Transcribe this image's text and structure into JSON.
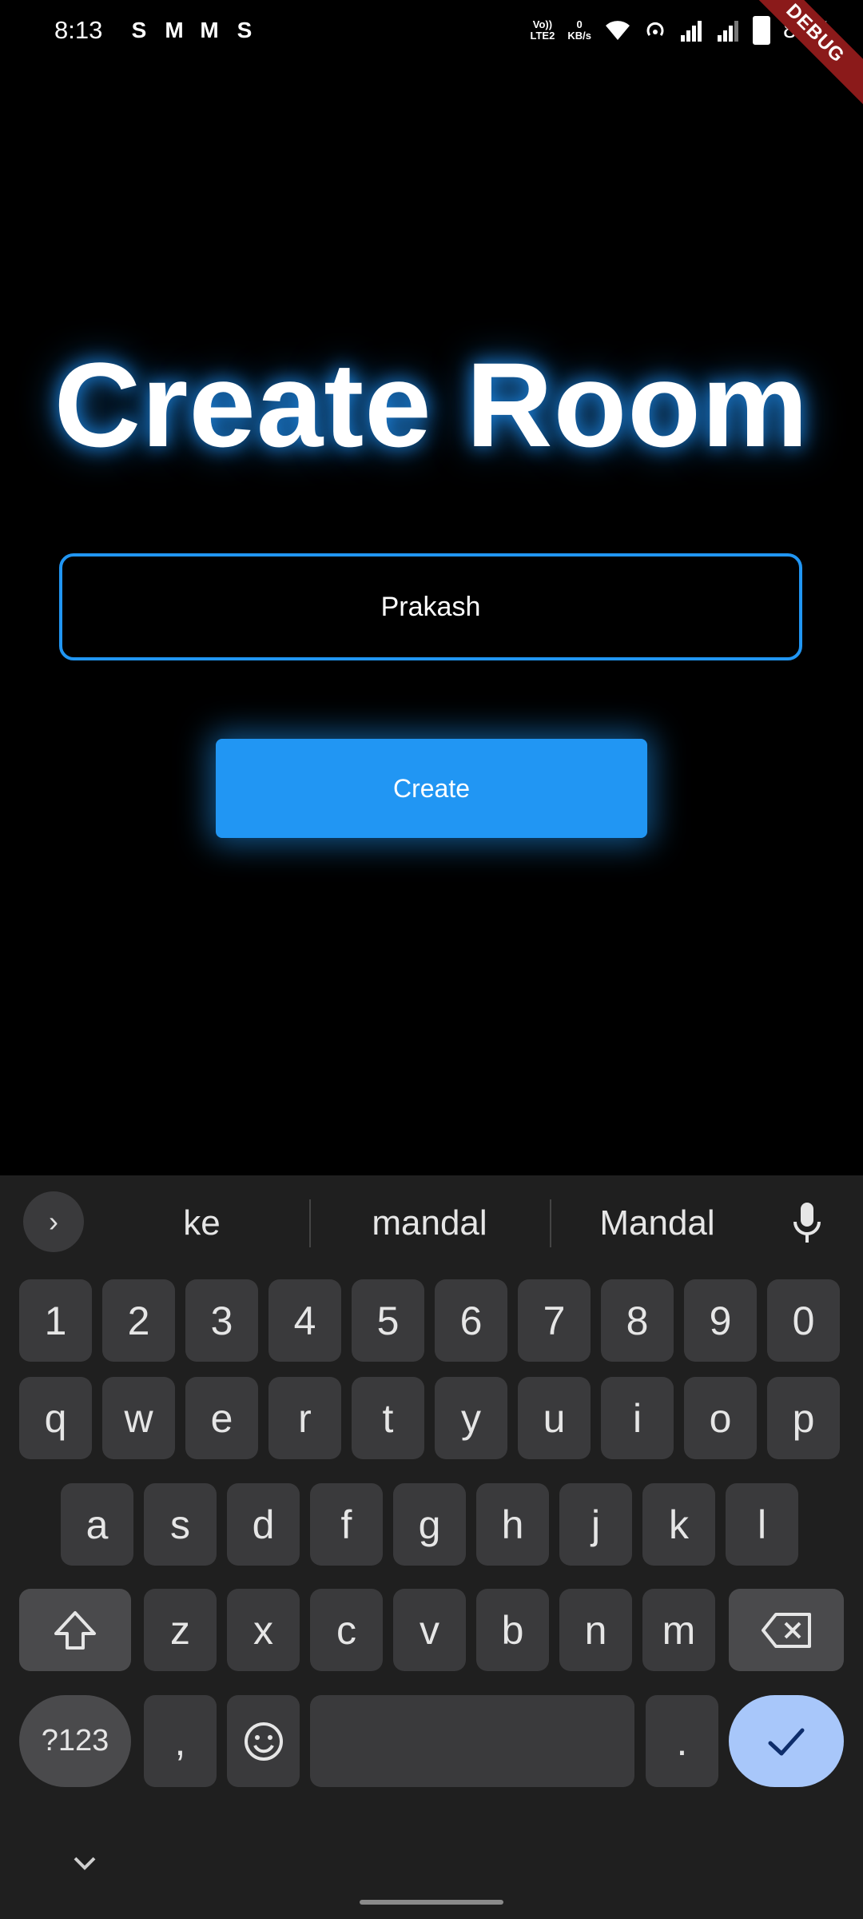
{
  "status_bar": {
    "time": "8:13",
    "notifications": [
      "S",
      "M",
      "M",
      "S"
    ],
    "volte": "Vo))",
    "volte2": "LTE2",
    "net_speed": "0",
    "net_unit": "KB/s",
    "battery": "86%",
    "debug_label": "DEBUG"
  },
  "main": {
    "title": "Create Room",
    "name_value": "Prakash",
    "create_label": "Create",
    "accent_color": "#2196f3"
  },
  "keyboard": {
    "suggestions": [
      "ke",
      "mandal",
      "Mandal"
    ],
    "number_row": [
      "1",
      "2",
      "3",
      "4",
      "5",
      "6",
      "7",
      "8",
      "9",
      "0"
    ],
    "row1": [
      "q",
      "w",
      "e",
      "r",
      "t",
      "y",
      "u",
      "i",
      "o",
      "p"
    ],
    "row2": [
      "a",
      "s",
      "d",
      "f",
      "g",
      "h",
      "j",
      "k",
      "l"
    ],
    "row3": [
      "z",
      "x",
      "c",
      "v",
      "b",
      "n",
      "m"
    ],
    "symbols_label": "?123",
    "comma": ",",
    "period": ".",
    "icons": {
      "expand": "chevron-right-icon",
      "mic": "mic-icon",
      "shift": "shift-icon",
      "backspace": "backspace-icon",
      "emoji": "emoji-icon",
      "enter": "check-icon",
      "hide": "chevron-down-icon"
    }
  }
}
